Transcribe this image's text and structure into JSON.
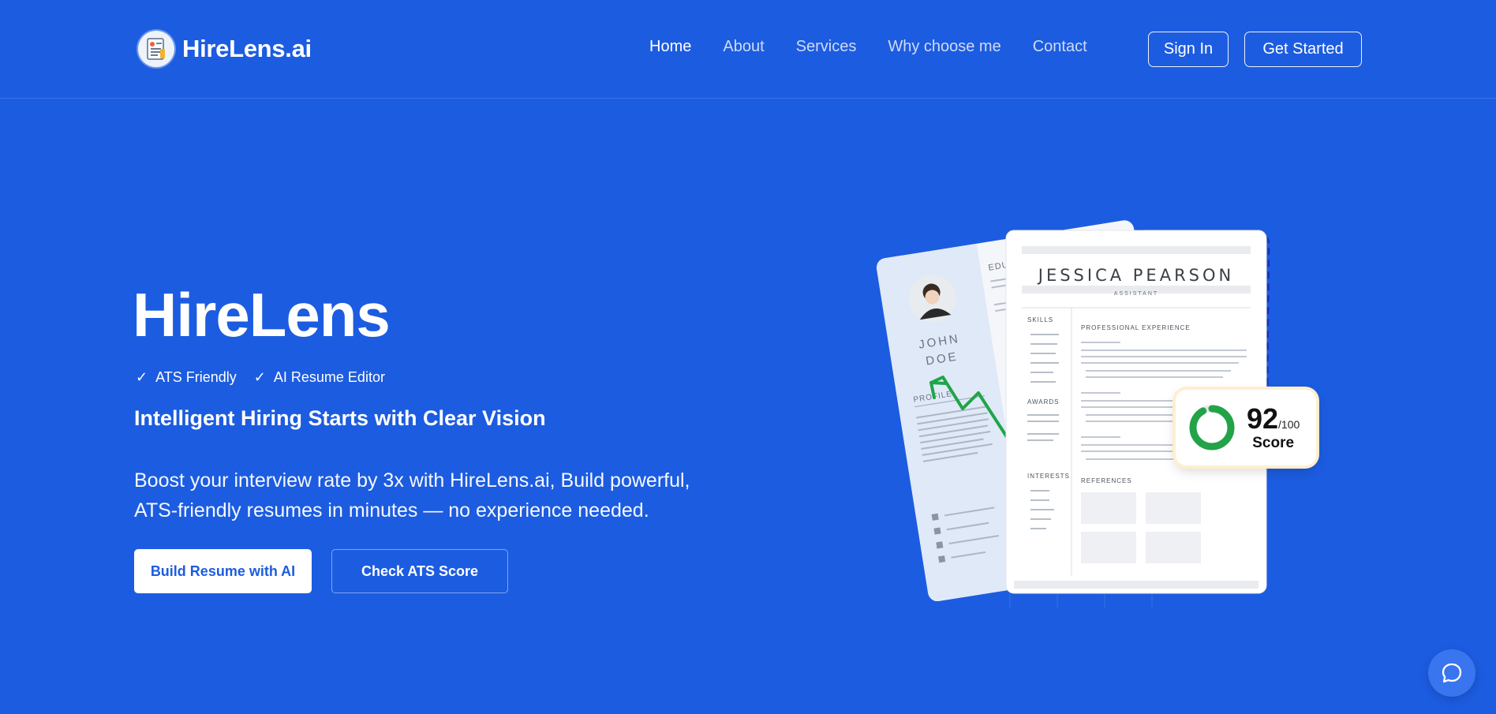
{
  "brand": {
    "name": "HireLens.ai",
    "logo_icon": "resume-document-icon"
  },
  "nav": {
    "items": [
      {
        "label": "Home",
        "active": true
      },
      {
        "label": "About",
        "active": false
      },
      {
        "label": "Services",
        "active": false
      },
      {
        "label": "Why choose me",
        "active": false
      },
      {
        "label": "Contact",
        "active": false
      }
    ]
  },
  "header_actions": {
    "sign_in": "Sign In",
    "get_started": "Get Started"
  },
  "hero": {
    "title": "HireLens",
    "features": [
      {
        "icon": "check-icon",
        "label": "ATS Friendly"
      },
      {
        "icon": "check-icon",
        "label": "AI Resume Editor"
      }
    ],
    "tagline": "Intelligent Hiring Starts with Clear Vision",
    "description": "Boost your interview rate by 3x with HireLens.ai, Build powerful, ATS-friendly resumes in minutes — no experience needed.",
    "primary_cta": "Build Resume with AI",
    "secondary_cta": "Check ATS Score"
  },
  "illustration": {
    "back_resume": {
      "name_first": "JOHN",
      "name_last": "DOE",
      "section_profile": "PROFILE",
      "section_education": "EDUCATI"
    },
    "front_resume": {
      "name": "JESSICA PEARSON",
      "role": "ASSISTANT",
      "sections": [
        "SKILLS",
        "PROFESSIONAL EXPERIENCE",
        "AWARDS",
        "INTERESTS",
        "REFERENCES"
      ]
    },
    "score": {
      "value": "92",
      "max": "/100",
      "label": "Score",
      "fill": 0.92
    }
  },
  "chat": {
    "icon": "chat-bubble-icon"
  },
  "colors": {
    "background": "#1c5ce0",
    "primary": "#ffffff",
    "score_ring": "#22a347",
    "trend_arrow": "#1fa54a"
  }
}
